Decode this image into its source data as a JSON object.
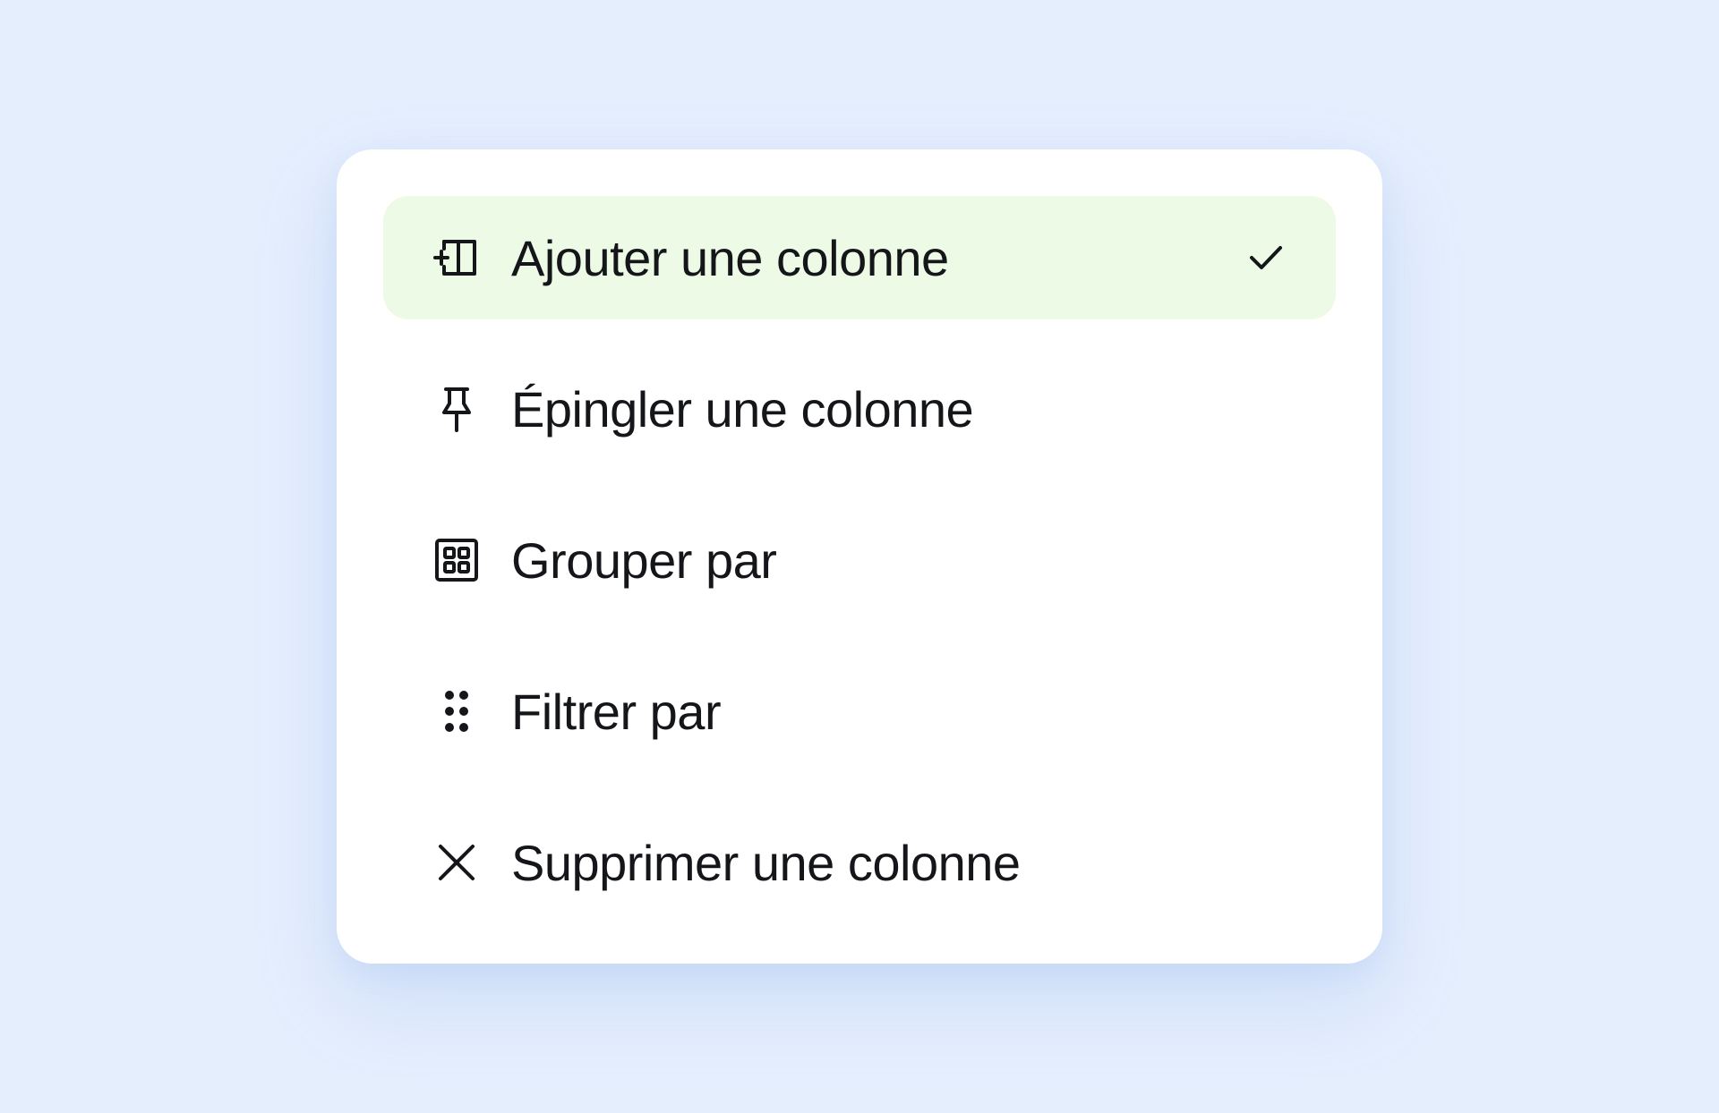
{
  "menu": {
    "items": [
      {
        "label": "Ajouter une colonne",
        "icon": "add-column-icon",
        "selected": true
      },
      {
        "label": "Épingler une colonne",
        "icon": "pin-icon",
        "selected": false
      },
      {
        "label": "Grouper par",
        "icon": "group-grid-icon",
        "selected": false
      },
      {
        "label": "Filtrer par",
        "icon": "drag-dots-icon",
        "selected": false
      },
      {
        "label": "Supprimer une colonne",
        "icon": "close-icon",
        "selected": false
      }
    ],
    "selected_check_icon": "checkmark-icon"
  },
  "colors": {
    "background": "#e5eefd",
    "menu_background": "#ffffff",
    "selected_background": "#edfbe6",
    "text": "#14161a"
  }
}
